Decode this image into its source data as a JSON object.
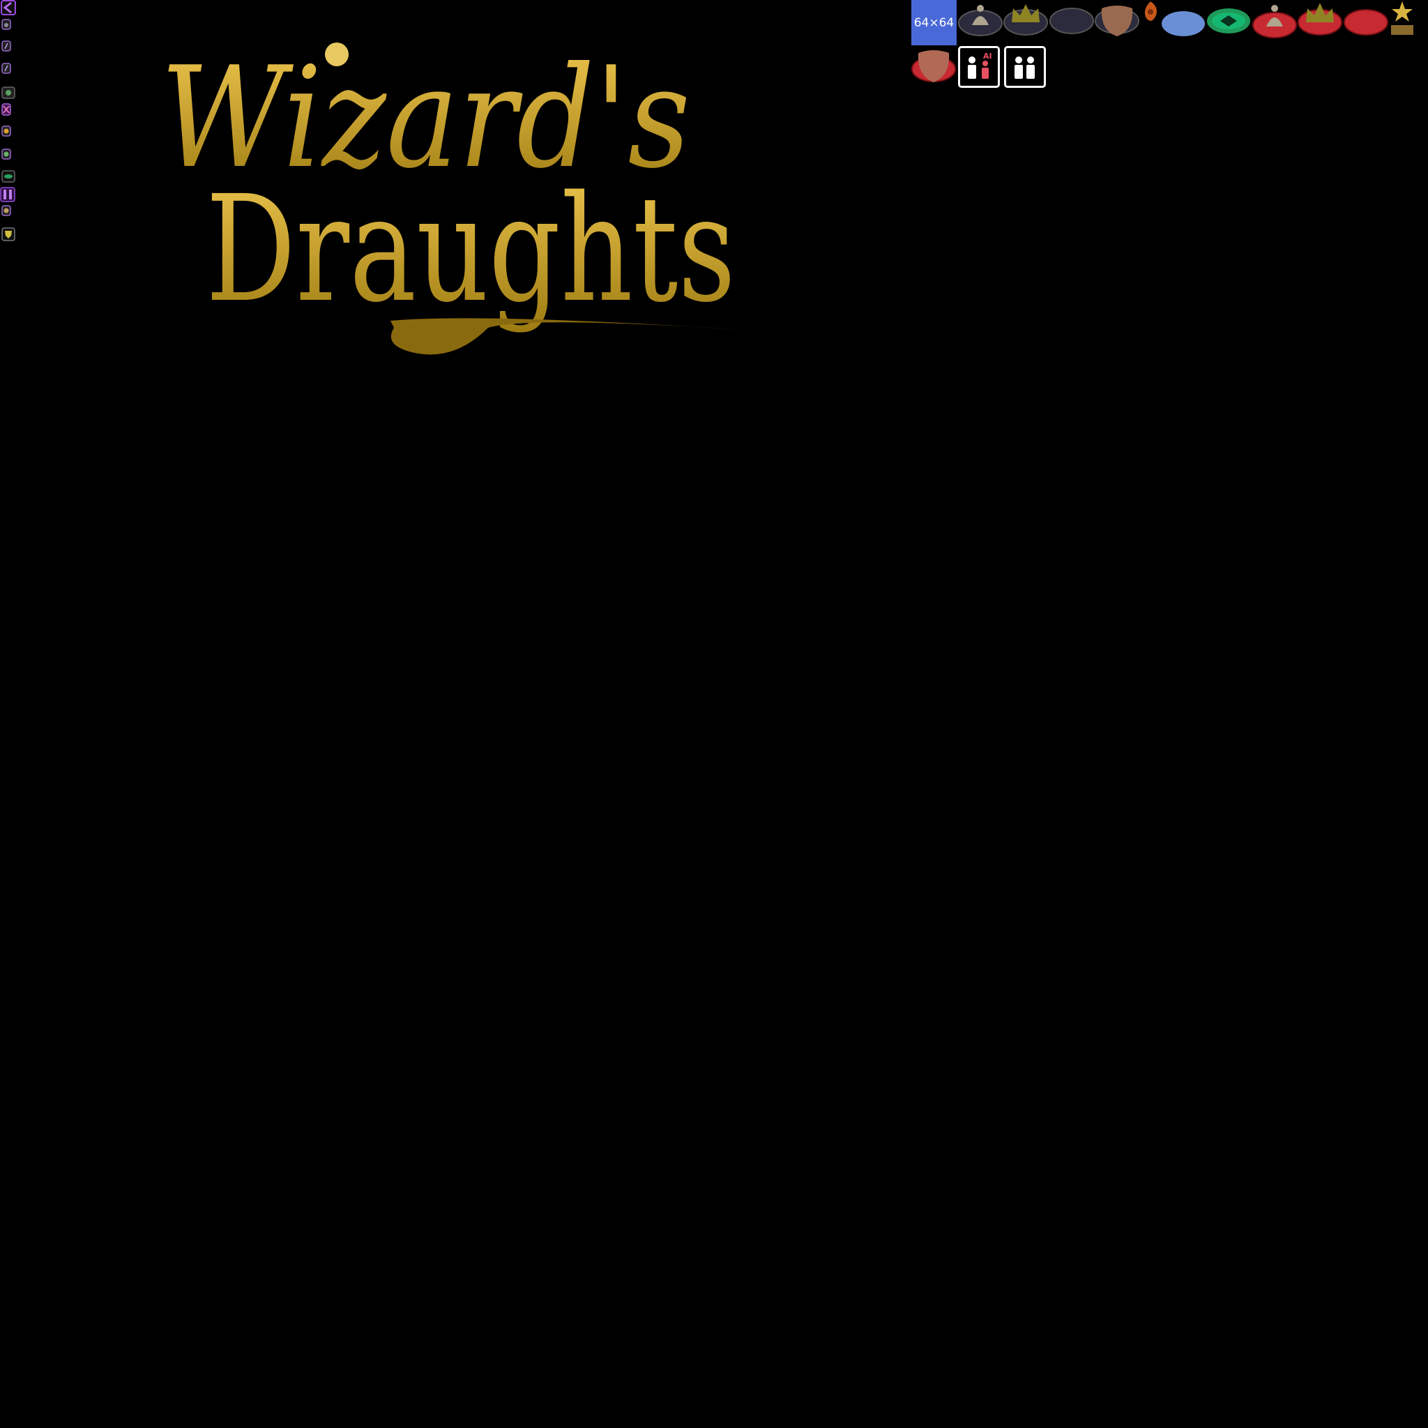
{
  "logo": {
    "line1": "Wizard's",
    "line2": "Draughts",
    "gradient_top": "#f0c850",
    "gradient_bottom": "#9c7a10"
  },
  "atlas": {
    "size_label": "64×64",
    "size_label_bg": "#4a69d8",
    "pieces": [
      {
        "icon": "dark-wizard-piece-icon"
      },
      {
        "icon": "dark-king-piece-icon"
      },
      {
        "icon": "dark-piece-icon"
      },
      {
        "icon": "dark-shield-piece-icon"
      },
      {
        "icon": "fire-orb-icon"
      },
      {
        "icon": "highlight-blue-disc-icon"
      },
      {
        "icon": "emerald-disc-icon"
      },
      {
        "icon": "red-wizard-piece-icon"
      },
      {
        "icon": "red-king-piece-icon"
      },
      {
        "icon": "red-piece-icon"
      },
      {
        "icon": "star-icon"
      },
      {
        "icon": "red-shield-piece-icon"
      }
    ],
    "mode_buttons": [
      {
        "icon": "player-vs-ai-icon",
        "text": "AI"
      },
      {
        "icon": "player-vs-player-icon"
      }
    ]
  },
  "sidebar_icons": [
    {
      "icon": "back-arrow-icon"
    },
    {
      "icon": "potion-icon"
    },
    {
      "icon": "rune-icon"
    },
    {
      "icon": "rune-icon"
    },
    {
      "icon": "goblin-icon"
    },
    {
      "icon": "cross-icon"
    },
    {
      "icon": "orange-gem-icon"
    },
    {
      "icon": "green-gem-icon"
    },
    {
      "icon": "eye-icon"
    },
    {
      "icon": "pause-icon"
    },
    {
      "icon": "lantern-icon"
    },
    {
      "icon": "shield-icon"
    }
  ]
}
